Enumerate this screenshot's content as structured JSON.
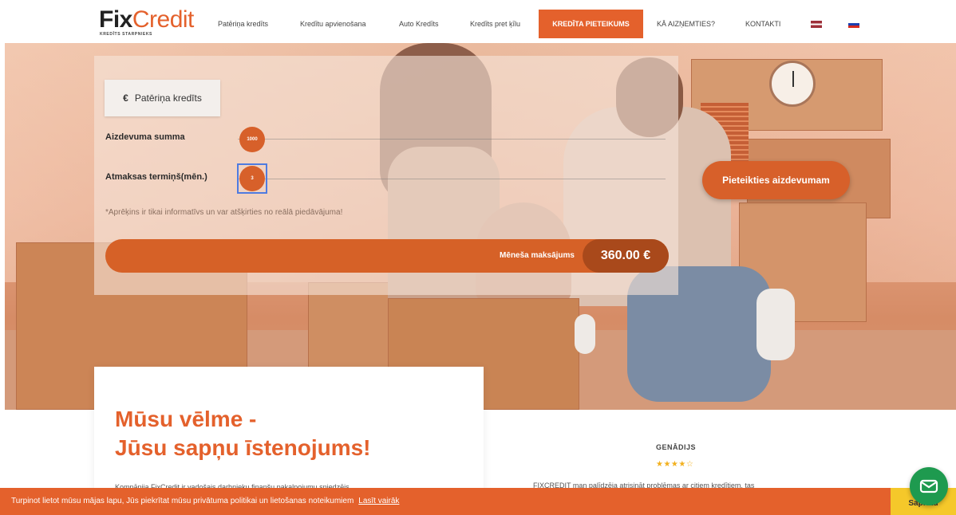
{
  "header": {
    "logo": {
      "main_part1": "Fix",
      "main_part2": "Credit",
      "tagline": "KREDĪTS STARPNIEKS"
    },
    "nav": [
      {
        "label": "Patēriņa kredīts"
      },
      {
        "label": "Kredītu apvienošana"
      },
      {
        "label": "Auto Kredīts"
      },
      {
        "label": "Kredīts pret ķīlu"
      },
      {
        "label": "KREDĪTA PIETEIKUMS",
        "active": true
      },
      {
        "label": "KĀ AIZŅEMTIES?"
      },
      {
        "label": "KONTAKTI"
      }
    ],
    "languages": [
      "lv-flag-icon",
      "ru-flag-icon"
    ]
  },
  "calculator": {
    "tab_icon": "€",
    "tab_label": "Patēriņa kredīts",
    "amount_label": "Aizdevuma summa",
    "amount_value": "1000",
    "term_label": "Atmaksas termiņš(mēn.)",
    "term_value": "3",
    "note": "*Aprēķins ir tikai informatīvs un var atšķirties no reālā piedāvājuma!",
    "monthly_label": "Mēneša maksājums",
    "monthly_value": "360.00 €"
  },
  "hero": {
    "apply_button": "Pieteikties aizdevumam"
  },
  "mission": {
    "title_line1": "Mūsu vēlme -",
    "title_line2": "Jūsu sapņu īstenojums!",
    "text": "Kompānija FixCredit ir vadošais darbnieku finanšu pakalpojumu sniedzējs"
  },
  "review": {
    "name": "GENĀDIJS",
    "stars": "★★★★☆",
    "text": "FIXCREDIT man palīdzēja atrisināt problēmas ar citiem kredītiem, tas"
  },
  "cookie": {
    "text": "Turpinot lietot mūsu mājas lapu, Jūs piekrītat mūsu privātuma politikai un lietošanas noteikumiem",
    "link": "Lasīt vairāk",
    "accept": "Sapratu"
  },
  "colors": {
    "accent": "#e4612c",
    "accent_dark": "#a9491b",
    "chat": "#1e9a4f",
    "cookie_accept": "#f5c82a"
  }
}
